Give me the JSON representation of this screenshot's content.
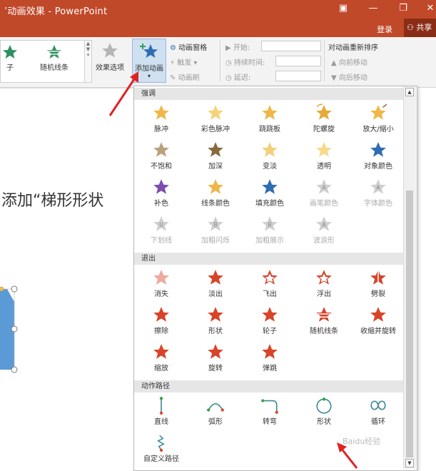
{
  "window": {
    "title": "’动画效果 - PowerPoint",
    "login": "登录",
    "share": "共享"
  },
  "ribbon": {
    "gallery": [
      {
        "label": "子",
        "icon": "star-green-icon"
      },
      {
        "label": "随机线条",
        "icon": "random-bars-star-icon"
      }
    ],
    "effect_options": "效果选项",
    "add_animation": "添加动画",
    "animation_pane": "动画窗格",
    "trigger": "触发",
    "animation_painter": "动画刷",
    "start": "开始:",
    "duration": "持续时间:",
    "delay": "延迟:",
    "reorder_title": "对动画重新排序",
    "move_earlier": "向前移动",
    "move_later": "向后移动"
  },
  "slide": {
    "text": "添加“梯形形状"
  },
  "panel": {
    "emphasis_header": "强调",
    "emphasis": [
      {
        "label": "脉冲",
        "icon": "pulse-star-icon",
        "enabled": true
      },
      {
        "label": "彩色脉冲",
        "icon": "color-pulse-star-icon",
        "enabled": true
      },
      {
        "label": "跷跷板",
        "icon": "teeter-star-icon",
        "enabled": true
      },
      {
        "label": "陀螺旋",
        "icon": "spin-star-icon",
        "enabled": true
      },
      {
        "label": "放大/缩小",
        "icon": "grow-shrink-star-icon",
        "enabled": true
      },
      {
        "label": "不饱和",
        "icon": "desaturate-star-icon",
        "enabled": true
      },
      {
        "label": "加深",
        "icon": "darken-star-icon",
        "enabled": true
      },
      {
        "label": "变淡",
        "icon": "lighten-star-icon",
        "enabled": true
      },
      {
        "label": "透明",
        "icon": "transparency-star-icon",
        "enabled": true
      },
      {
        "label": "对象颜色",
        "icon": "object-color-star-icon",
        "enabled": true
      },
      {
        "label": "补色",
        "icon": "complementary-color-star-icon",
        "enabled": true
      },
      {
        "label": "线条颜色",
        "icon": "line-color-star-icon",
        "enabled": true
      },
      {
        "label": "填充颜色",
        "icon": "fill-color-star-icon",
        "enabled": true
      },
      {
        "label": "画笔颜色",
        "icon": "brush-color-icon",
        "enabled": false
      },
      {
        "label": "字体颜色",
        "icon": "font-color-icon",
        "enabled": false
      },
      {
        "label": "下划线",
        "icon": "underline-icon",
        "enabled": false
      },
      {
        "label": "加粗闪烁",
        "icon": "bold-flash-icon",
        "enabled": false
      },
      {
        "label": "加粗展示",
        "icon": "bold-reveal-icon",
        "enabled": false
      },
      {
        "label": "波浪形",
        "icon": "wave-icon",
        "enabled": false
      }
    ],
    "exit_header": "退出",
    "exit": [
      {
        "label": "消失",
        "icon": "disappear-star-icon"
      },
      {
        "label": "淡出",
        "icon": "fade-star-icon"
      },
      {
        "label": "飞出",
        "icon": "fly-out-star-icon"
      },
      {
        "label": "浮出",
        "icon": "float-out-star-icon"
      },
      {
        "label": "劈裂",
        "icon": "split-star-icon"
      },
      {
        "label": "擦除",
        "icon": "wipe-star-icon"
      },
      {
        "label": "形状",
        "icon": "shape-star-icon"
      },
      {
        "label": "轮子",
        "icon": "wheel-star-icon"
      },
      {
        "label": "随机线条",
        "icon": "random-bars-star-icon"
      },
      {
        "label": "收缩并旋转",
        "icon": "shrink-turn-star-icon"
      },
      {
        "label": "缩放",
        "icon": "zoom-star-icon"
      },
      {
        "label": "旋转",
        "icon": "swivel-star-icon"
      },
      {
        "label": "弹跳",
        "icon": "bounce-star-icon"
      }
    ],
    "motion_header": "动作路径",
    "motion": [
      {
        "label": "直线",
        "icon": "line-path-icon"
      },
      {
        "label": "弧形",
        "icon": "arc-path-icon"
      },
      {
        "label": "转弯",
        "icon": "turn-path-icon"
      },
      {
        "label": "形状",
        "icon": "shape-path-icon"
      },
      {
        "label": "循环",
        "icon": "loop-path-icon"
      },
      {
        "label": "自定义路径",
        "icon": "custom-path-icon"
      }
    ]
  },
  "colors": {
    "titlebar": "#c0492a",
    "star_gold": "#f0b648",
    "exit_red": "#d8442a",
    "path_teal": "#3d8a95",
    "annotation_red": "#e02222"
  },
  "watermark": "Baidu经验"
}
